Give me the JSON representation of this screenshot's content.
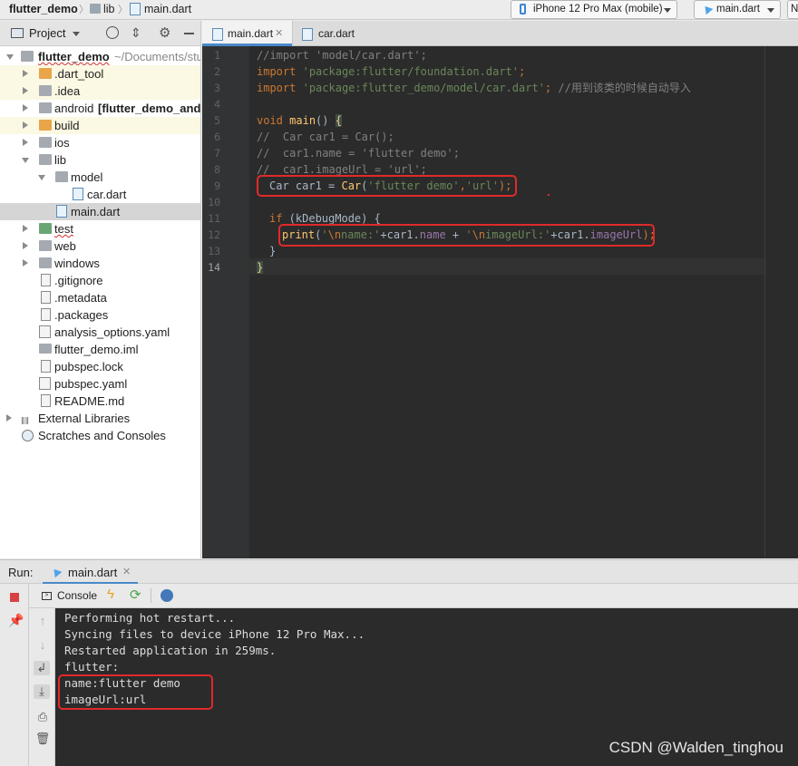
{
  "breadcrumb": {
    "project": "flutter_demo",
    "folder": "lib",
    "file": "main.dart"
  },
  "toolbar": {
    "device_selector": "iPhone 12 Pro Max (mobile)",
    "run_config": "main.dart",
    "overflow_letter": "N"
  },
  "project_panel": {
    "title": "Project",
    "root_name": "flutter_demo",
    "root_path": "~/Documents/stu",
    "items": [
      {
        "label": "dart_tool",
        "prefix": "."
      },
      {
        "label": "idea",
        "prefix": "."
      },
      {
        "label": "android",
        "bold_suffix": "[flutter_demo_andr"
      },
      {
        "label": "build"
      },
      {
        "label": "ios"
      },
      {
        "label": "lib"
      },
      {
        "label": "model"
      },
      {
        "label": "car.dart"
      },
      {
        "label": "main.dart"
      },
      {
        "label": "test"
      },
      {
        "label": "web"
      },
      {
        "label": "windows"
      },
      {
        "label": ".gitignore"
      },
      {
        "label": ".metadata"
      },
      {
        "label": ".packages"
      },
      {
        "label": "analysis_options.yaml"
      },
      {
        "label": "flutter_demo.iml"
      },
      {
        "label": "pubspec.lock"
      },
      {
        "label": "pubspec.yaml"
      },
      {
        "label": "README.md"
      },
      {
        "label": "External Libraries"
      },
      {
        "label": "Scratches and Consoles"
      }
    ]
  },
  "editor_tabs": [
    {
      "label": "main.dart",
      "active": true
    },
    {
      "label": "car.dart",
      "active": false
    }
  ],
  "code": {
    "line_numbers": [
      "1",
      "2",
      "3",
      "4",
      "5",
      "6",
      "7",
      "8",
      "9",
      "10",
      "11",
      "12",
      "13",
      "14"
    ],
    "l1": "//import 'model/car.dart';",
    "l2_kw": "import",
    "l2_str": "'package:flutter/foundation.dart'",
    "l2_end": ";",
    "l3_kw": "import",
    "l3_str": "'package:flutter_demo/model/car.dart'",
    "l3_end": ";",
    "l3_cmt": "//用到该类的时候自动导入",
    "l5_kw": "void",
    "l5_fn": "main",
    "l5_rest": "() ",
    "l5_brace": "{",
    "l6": "//  Car car1 = Car();",
    "l7": "//  car1.name = 'flutter demo';",
    "l8": "//  car1.imageUrl = 'url';",
    "l9_a": "Car car1 = ",
    "l9_fn": "Car",
    "l9_b": "(",
    "l9_s1": "'flutter demo'",
    "l9_c": ",",
    "l9_s2": "'url'",
    "l9_d": ");",
    "l11_kw": "if",
    "l11_rest": " (kDebugMode) {",
    "l12_fn": "print",
    "l12_p": "(",
    "l12_s1q": "'",
    "l12_s1e": "\\n",
    "l12_s1t": "name:'",
    "l12_plus1": "+car1.",
    "l12_f1": "name",
    "l12_plus2": " + ",
    "l12_s2q": "'",
    "l12_s2e": "\\n",
    "l12_s2t": "imageUrl:'",
    "l12_plus3": "+car1.",
    "l12_f2": "imageUrl",
    "l12_end": ");",
    "l13": "}",
    "l14_brace": "}"
  },
  "run_panel": {
    "label": "Run:",
    "tab": "main.dart",
    "console_tab": "Console",
    "output": [
      "Performing hot restart...",
      "Syncing files to device iPhone 12 Pro Max...",
      "Restarted application in 259ms.",
      "flutter:",
      "name:flutter demo",
      "imageUrl:url"
    ]
  },
  "watermark": "CSDN @Walden_tinghou",
  "colors": {
    "highlight_box": "#e02a2a",
    "editor_bg": "#2b2b2b",
    "keyword": "#cc7832",
    "string": "#6a8759",
    "function": "#ffc66d",
    "field": "#9876aa"
  }
}
